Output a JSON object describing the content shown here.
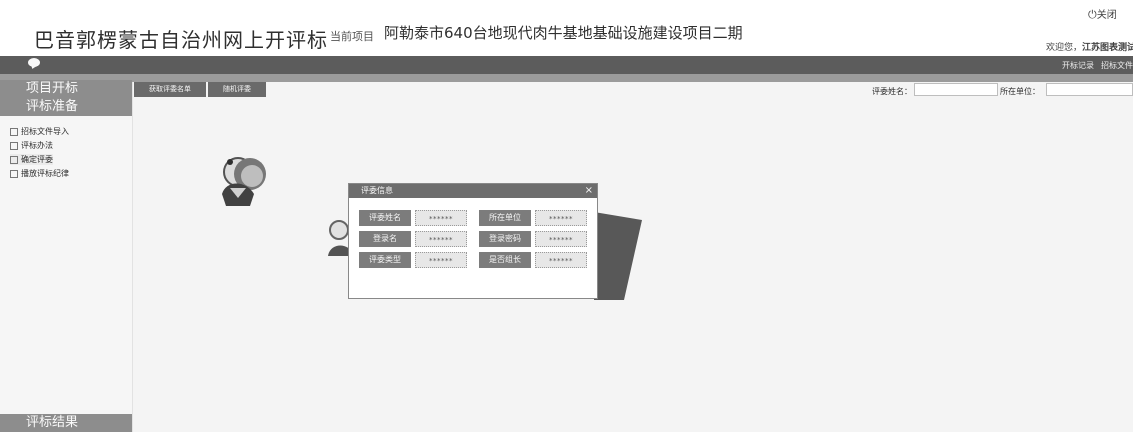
{
  "header": {
    "site_title": "巴音郭楞蒙古自治州网上开评标",
    "project_label": "当前项目",
    "project_name": "阿勒泰市640台地现代肉牛基地基础设施建设项目二期",
    "close_icon_glyph": "⏻",
    "close_label": "关闭",
    "welcome_prefix": "欢迎您，",
    "welcome_user": "江苏图表测试"
  },
  "navbar": {
    "links": [
      "开标记录",
      "招标文件"
    ]
  },
  "sidebar": {
    "section1": "项目开标",
    "section2": "评标准备",
    "items": [
      {
        "label": "招标文件导入",
        "icon": "document-icon"
      },
      {
        "label": "评标办法",
        "icon": "document-icon"
      },
      {
        "label": "确定评委",
        "icon": "document-icon"
      },
      {
        "label": "播放评标纪律",
        "icon": "document-icon"
      }
    ],
    "section3": "评标结果"
  },
  "tabs": [
    "获取评委名单",
    "随机评委"
  ],
  "filters": {
    "name_label": "评委姓名：",
    "unit_label": "所在单位："
  },
  "modal": {
    "title": "评委信息",
    "close_glyph": "×",
    "fields": [
      {
        "left_label": "评委姓名",
        "left_value": "******",
        "right_label": "所在单位",
        "right_value": "******"
      },
      {
        "left_label": "登录名",
        "left_value": "******",
        "right_label": "登录密码",
        "right_value": "******"
      },
      {
        "left_label": "评委类型",
        "left_value": "******",
        "right_label": "是否组长",
        "right_value": "******"
      }
    ]
  }
}
